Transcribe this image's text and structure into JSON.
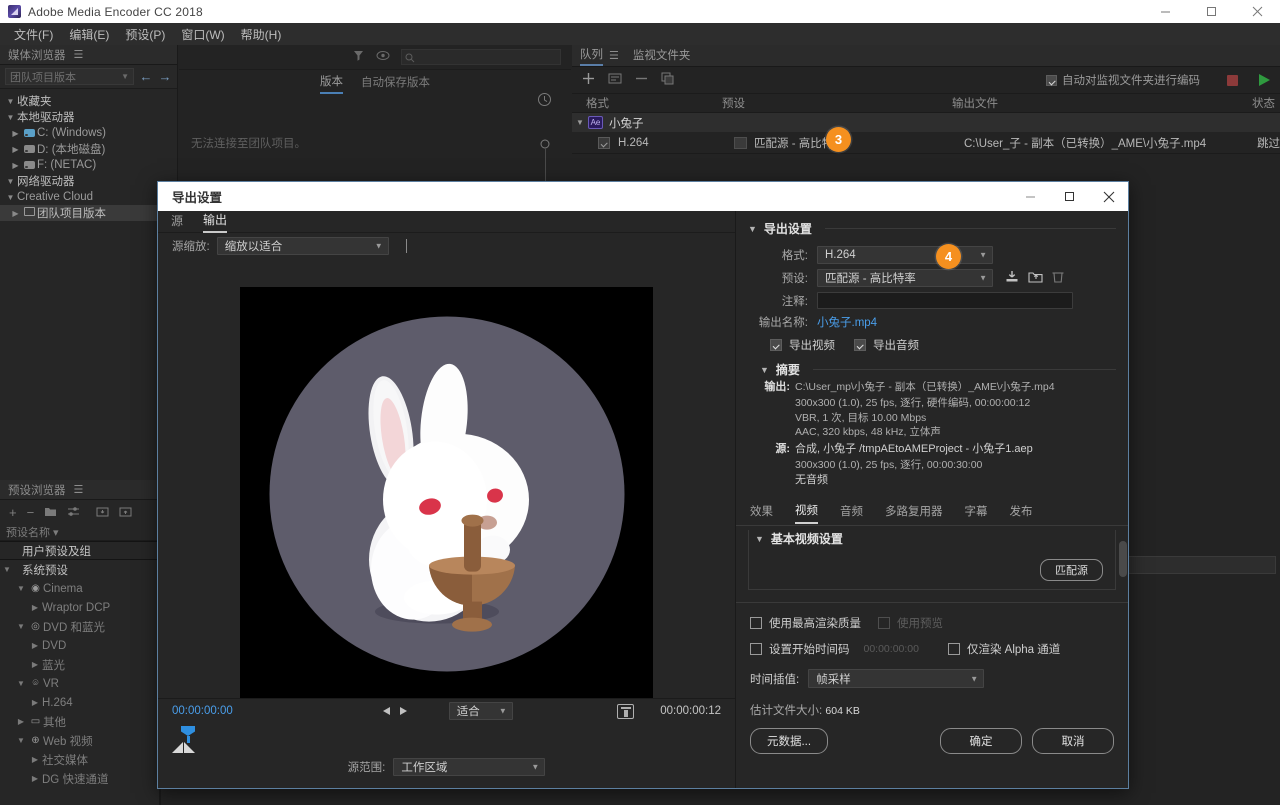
{
  "window": {
    "title": "Adobe Media Encoder CC 2018",
    "controls": {
      "minimize": "minimize-icon",
      "maximize": "maximize-icon",
      "close": "close-icon"
    }
  },
  "menubar": {
    "items": [
      "文件(F)",
      "编辑(E)",
      "预设(P)",
      "窗口(W)",
      "帮助(H)"
    ]
  },
  "media_browser": {
    "title": "媒体浏览器",
    "dropdown_value": "团队项目版本",
    "tree": [
      {
        "label": "收藏夹",
        "indent": 0,
        "twisty": "▼",
        "icon": ""
      },
      {
        "label": "本地驱动器",
        "indent": 0,
        "twisty": "▼",
        "icon": ""
      },
      {
        "label": "C: (Windows)",
        "indent": 1,
        "twisty": "▶",
        "icon": "drive-windows-icon"
      },
      {
        "label": "D: (本地磁盘)",
        "indent": 1,
        "twisty": "▶",
        "icon": "drive-icon"
      },
      {
        "label": "F: (NETAC)",
        "indent": 1,
        "twisty": "▶",
        "icon": "drive-icon"
      },
      {
        "label": "网络驱动器",
        "indent": 0,
        "twisty": "▼",
        "icon": ""
      },
      {
        "label": "Creative Cloud",
        "indent": 0,
        "twisty": "▼",
        "icon": ""
      },
      {
        "label": "团队项目版本",
        "indent": 1,
        "twisty": "▶",
        "icon": "cloud-project-icon",
        "selected": true
      }
    ]
  },
  "preset_browser": {
    "title": "预设浏览器",
    "toolbar_icons": [
      "add-preset-icon",
      "remove-preset-icon",
      "folder-preset-icon",
      "settings-preset-icon",
      "import-preset-icon",
      "export-preset-icon"
    ],
    "column_header": "预设名称 ▾",
    "rows": [
      {
        "label": "用户预设及组",
        "indent": 0,
        "twisty": "",
        "bold": true
      },
      {
        "label": "系统预设",
        "indent": 0,
        "twisty": "▼",
        "bold": true
      },
      {
        "label": "Cinema",
        "indent": 1,
        "twisty": "▼",
        "icon": "cinema-icon"
      },
      {
        "label": "Wraptor DCP",
        "indent": 2,
        "twisty": "▶"
      },
      {
        "label": "DVD 和蓝光",
        "indent": 1,
        "twisty": "▼",
        "icon": "disc-icon"
      },
      {
        "label": "DVD",
        "indent": 2,
        "twisty": "▶"
      },
      {
        "label": "蓝光",
        "indent": 2,
        "twisty": "▶"
      },
      {
        "label": "VR",
        "indent": 1,
        "twisty": "▼",
        "icon": "vr-icon"
      },
      {
        "label": "H.264",
        "indent": 2,
        "twisty": "▶"
      },
      {
        "label": "其他",
        "indent": 1,
        "twisty": "▶",
        "icon": "monitor-icon"
      },
      {
        "label": "Web 视频",
        "indent": 1,
        "twisty": "▼",
        "icon": "web-icon"
      },
      {
        "label": "社交媒体",
        "indent": 2,
        "twisty": "▶"
      },
      {
        "label": "DG 快速通道",
        "indent": 2,
        "twisty": "▶"
      }
    ]
  },
  "team_projects": {
    "tabs": [
      {
        "label": "版本",
        "active": true
      },
      {
        "label": "自动保存版本",
        "active": false
      }
    ],
    "empty_message": "无法连接至团队项目。",
    "toolbar_icons": [
      "filter-icon",
      "eye-icon",
      "search-icon"
    ],
    "search_placeholder": ""
  },
  "queue": {
    "tabs": [
      {
        "label": "队列",
        "active": true
      },
      {
        "label": "监视文件夹",
        "active": false
      }
    ],
    "toolbar_icons": [
      "add-icon",
      "add-comp-icon",
      "remove-icon",
      "duplicate-icon"
    ],
    "auto_encode_label": "自动对监视文件夹进行编码",
    "auto_encode_checked": true,
    "stop_icon": "stop-icon",
    "start_icon": "start-queue-icon",
    "columns": [
      "格式",
      "预设",
      "输出文件",
      "状态"
    ],
    "group_label": "小兔子",
    "group_badge": "Ae",
    "rows": [
      {
        "format": "H.264",
        "preset": "匹配源 - 高比特率",
        "output_file": "C:\\User_子 - 副本（已转换）_AME\\小兔子.mp4",
        "status": "跳过"
      }
    ]
  },
  "badges": [
    {
      "number": "3"
    },
    {
      "number": "4"
    }
  ],
  "dialog": {
    "title": "导出设置",
    "controls": {
      "minimize": "minimize-icon",
      "maximize": "maximize-icon",
      "close": "close-icon"
    },
    "source_tabs": [
      {
        "label": "源",
        "active": false
      },
      {
        "label": "输出",
        "active": true
      }
    ],
    "scale_label": "源缩放:",
    "scale_value": "缩放以适合",
    "player": {
      "current_time": "00:00:00:00",
      "duration": "00:00:00:12",
      "zoom_value": "适合",
      "loop_icon": "loop-range-icon",
      "range_label": "源范围:",
      "range_value": "工作区域"
    },
    "export_settings": {
      "section_title": "导出设置",
      "format_label": "格式:",
      "format_value": "H.264",
      "preset_label": "预设:",
      "preset_value": "匹配源 - 高比特率",
      "preset_icons": [
        "save-preset-icon",
        "import-preset-icon",
        "delete-preset-icon"
      ],
      "comment_label": "注释:",
      "comment_value": "",
      "output_name_label": "输出名称:",
      "output_name_value": "小兔子.mp4",
      "export_video_label": "导出视频",
      "export_video_checked": true,
      "export_audio_label": "导出音频",
      "export_audio_checked": true
    },
    "summary": {
      "section_title": "摘要",
      "output_key": "输出:",
      "output_lines": [
        "C:\\User_mp\\小兔子 - 副本（已转换）_AME\\小兔子.mp4",
        "300x300 (1.0), 25 fps, 逐行, 硬件编码, 00:00:00:12",
        "VBR, 1 次, 目标 10.00 Mbps",
        "AAC, 320 kbps, 48 kHz, 立体声"
      ],
      "source_key": "源:",
      "source_lines": [
        "合成, 小兔子 /tmpAEtoAMEProject - 小兔子1.aep",
        "300x300 (1.0), 25 fps, 逐行, 00:00:30:00",
        "无音频"
      ]
    },
    "output_tabs": [
      {
        "label": "效果",
        "active": false
      },
      {
        "label": "视频",
        "active": true
      },
      {
        "label": "音频",
        "active": false
      },
      {
        "label": "多路复用器",
        "active": false
      },
      {
        "label": "字幕",
        "active": false
      },
      {
        "label": "发布",
        "active": false
      }
    ],
    "video_settings": {
      "section_title": "基本视频设置",
      "match_source_button": "匹配源",
      "max_render_quality_label": "使用最高渲染质量",
      "max_render_quality_checked": false,
      "use_preview_label": "使用预览",
      "use_preview_checked": false,
      "use_preview_disabled": true,
      "start_timecode_label": "设置开始时间码",
      "start_timecode_checked": false,
      "start_timecode_value": "00:00:00:00",
      "alpha_only_label": "仅渲染 Alpha 通道",
      "alpha_only_checked": false,
      "time_interp_label": "时间插值:",
      "time_interp_value": "帧采样"
    },
    "footer": {
      "est_size_label": "估计文件大小:",
      "est_size_value": "604 KB",
      "metadata_button": "元数据...",
      "ok_button": "确定",
      "cancel_button": "取消"
    }
  },
  "colors": {
    "accent_orange": "#f5901f",
    "link_blue": "#4a9eea",
    "dialog_border": "#5c7fa0",
    "app_bg": "#232323"
  }
}
